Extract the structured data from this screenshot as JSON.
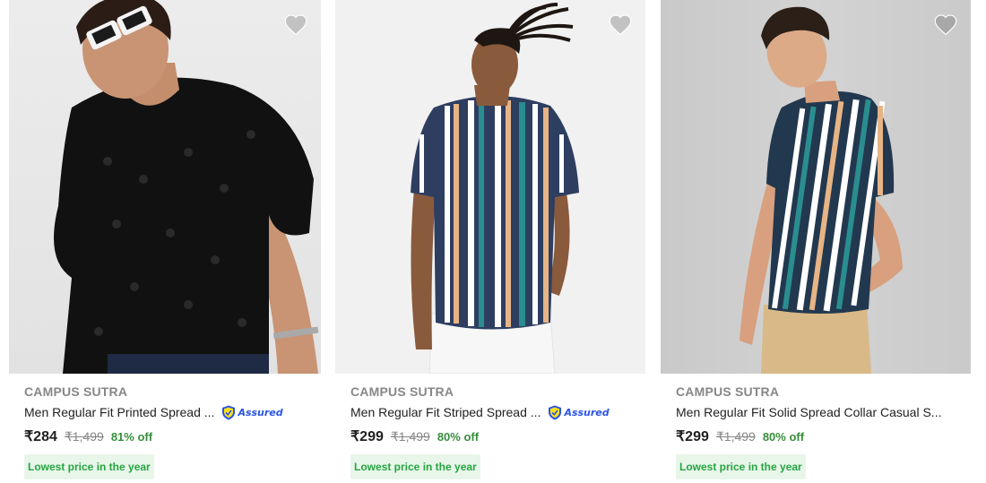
{
  "products": [
    {
      "brand": "CAMPUS SUTRA",
      "title": "Men Regular Fit Printed Spread ...",
      "assured": true,
      "assured_label": "Assured",
      "price": "₹284",
      "mrp": "₹1,499",
      "discount": "81% off",
      "tag": "Lowest price in the year",
      "image": "man-black-textured-shirt-sunglasses"
    },
    {
      "brand": "CAMPUS SUTRA",
      "title": "Men Regular Fit Striped Spread ...",
      "assured": true,
      "assured_label": "Assured",
      "price": "₹299",
      "mrp": "₹1,499",
      "discount": "80% off",
      "tag": "Lowest price in the year",
      "image": "man-navy-striped-shirt-white-jeans"
    },
    {
      "brand": "CAMPUS SUTRA",
      "title": "Men Regular Fit Solid Spread Collar Casual S...",
      "assured": false,
      "price": "₹299",
      "mrp": "₹1,499",
      "discount": "80% off",
      "tag": "Lowest price in the year",
      "image": "man-teal-striped-shirt-beige-pants"
    }
  ],
  "icons": {
    "wishlist": "heart-icon",
    "assured": "flipkart-assured-shield-icon"
  },
  "colors": {
    "discount": "#388e3c",
    "tag_bg": "#e8f6ea",
    "tag_text": "#26a541",
    "assured": "#2a55e5",
    "brand": "#878787"
  }
}
